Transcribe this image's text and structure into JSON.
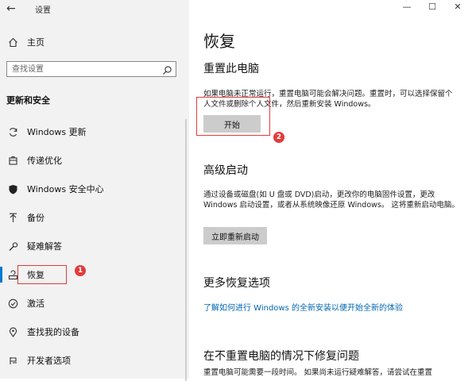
{
  "window": {
    "app_title": "设置"
  },
  "sidebar": {
    "home_label": "主页",
    "search_placeholder": "查找设置",
    "section_title": "更新和安全",
    "items": [
      {
        "label": "Windows 更新",
        "icon": "sync-icon"
      },
      {
        "label": "传递优化",
        "icon": "delivery-optimization-icon"
      },
      {
        "label": "Windows 安全中心",
        "icon": "shield-icon"
      },
      {
        "label": "备份",
        "icon": "backup-arrow-icon"
      },
      {
        "label": "疑难解答",
        "icon": "wrench-icon"
      },
      {
        "label": "恢复",
        "icon": "recovery-icon",
        "selected": true
      },
      {
        "label": "激活",
        "icon": "activation-check-icon"
      },
      {
        "label": "查找我的设备",
        "icon": "find-device-icon"
      },
      {
        "label": "开发者选项",
        "icon": "developer-icon"
      }
    ]
  },
  "main": {
    "page_title": "恢复",
    "reset": {
      "heading": "重置此电脑",
      "description": "如果电脑未正常运行，重置电脑可能会解决问题。重置时，可以选择保留个人文件或删除个人文件，然后重新安装 Windows。",
      "button": "开始"
    },
    "advanced": {
      "heading": "高级启动",
      "description": "通过设备或磁盘(如 U 盘或 DVD)启动，更改你的电脑固件设置，更改 Windows 启动设置，或者从系统映像还原 Windows。 这将重新启动电脑。",
      "button": "立即重新启动"
    },
    "more": {
      "heading": "更多恢复选项",
      "link": "了解如何进行 Windows 的全新安装以便开始全新的体验"
    },
    "fix": {
      "heading": "在不重置电脑的情况下修复问题",
      "description": "重置电脑可能需要一段时间。 如果尚未运行疑难解答，请尝试在重置"
    }
  },
  "annotations": {
    "badge1": "1",
    "badge2": "2",
    "color": "#e23b3b"
  },
  "colors": {
    "accent": "#0078d7",
    "link": "#0066b4",
    "sidebar_bg": "#f2f2f2",
    "button_bg": "#cccccc"
  }
}
